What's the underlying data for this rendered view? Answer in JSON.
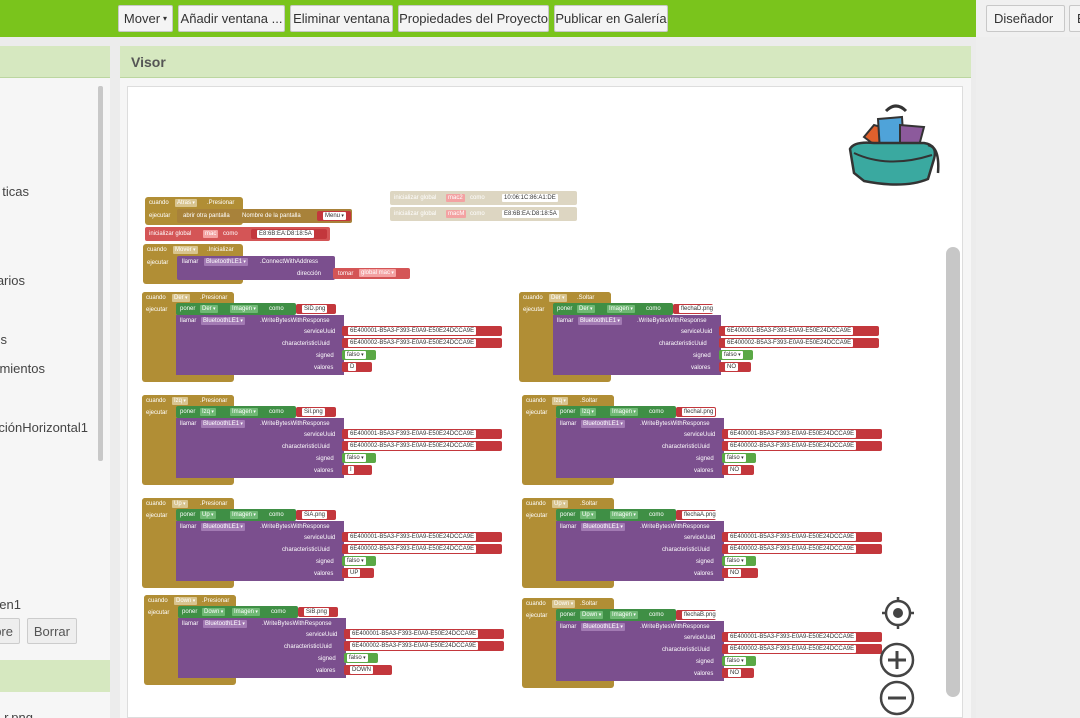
{
  "toolbar": {
    "move": "Mover",
    "add_screen": "Añadir ventana ...",
    "remove_screen": "Eliminar ventana",
    "project_props": "Propiedades del Proyecto",
    "publish": "Publicar en Galería",
    "designer": "Diseñador",
    "blocks": "Bloques"
  },
  "left_panel": {
    "items": [
      "ticas",
      "arios",
      "s",
      "mientos",
      "ciónHorizontal1",
      "en1",
      "r.png"
    ],
    "rename_button": "bre",
    "delete_button": "Borrar"
  },
  "viewer": {
    "title": "Visor",
    "globals": [
      {
        "kw": "inicializar global",
        "name": "mac2",
        "as": "como",
        "value": "10:06:1C:86:A1:DE"
      },
      {
        "kw": "inicializar global",
        "name": "macM",
        "as": "como",
        "value": "E8:6B:EA:D8:18:5A"
      },
      {
        "kw": "inicializar global",
        "name": "mac",
        "as": "como",
        "value": "E8:6B:EA:D8:18:5A"
      }
    ],
    "atras": {
      "when": "cuando",
      "comp": "Atras",
      "event": ".Presionar",
      "do": "ejecutar",
      "call": "abrir otra pantalla",
      "param": "Nombre de la pantalla",
      "value": "Menu"
    },
    "mover": {
      "when": "cuando",
      "comp": "Mover",
      "event": ".Inicializar",
      "do": "ejecutar",
      "call": "llamar",
      "device": "BluetoothLE1",
      "method": ".ConnectWithAddress",
      "param": "dirección",
      "get": "tomar",
      "var": "global mac"
    },
    "labels": {
      "when": "cuando",
      "do": "ejecutar",
      "set": "poner",
      "image_prop": "Imagen",
      "as": "como",
      "call": "llamar",
      "device": "BluetoothLE1",
      "method": ".WriteBytesWithResponse",
      "service": "serviceUuid",
      "characteristic": "characteristicUuid",
      "signed": "signed",
      "values": "valores",
      "service_uuid": "6E400001-B5A3-F393-E0A9-E50E24DCCA9E",
      "char_uuid": "6E400002-B5A3-F393-E0A9-E50E24DCCA9E",
      "false": "falso"
    },
    "handlers": [
      {
        "comp": "Der",
        "event": ".Presionar",
        "img": "SiD.png",
        "value": "D"
      },
      {
        "comp": "Der",
        "event": ".Soltar",
        "img": "flechaD.png",
        "value": "NO"
      },
      {
        "comp": "Izq",
        "event": ".Presionar",
        "img": "SiI.png",
        "value": "I"
      },
      {
        "comp": "Izq",
        "event": ".Soltar",
        "img": "flechaI.png",
        "value": "NO"
      },
      {
        "comp": "Up",
        "event": ".Presionar",
        "img": "SiA.png",
        "value": "UP"
      },
      {
        "comp": "Up",
        "event": ".Soltar",
        "img": "flechaA.png",
        "value": "NO"
      },
      {
        "comp": "Down",
        "event": ".Presionar",
        "img": "SiB.png",
        "value": "DOWN"
      },
      {
        "comp": "Down",
        "event": ".Soltar",
        "img": "flechaB.png",
        "value": "NO"
      }
    ]
  },
  "colors": {
    "topbar": "#7ac41c",
    "event_block": "#b18e35",
    "procedure_block": "#7b4f8e",
    "text_block": "#c3373c",
    "logic_block": "#5aa845",
    "component_block": "#3f8f45",
    "variable_block": "#d45556"
  },
  "icons": [
    "backpack-icon",
    "recenter-icon",
    "zoom-in-icon",
    "zoom-out-icon"
  ]
}
